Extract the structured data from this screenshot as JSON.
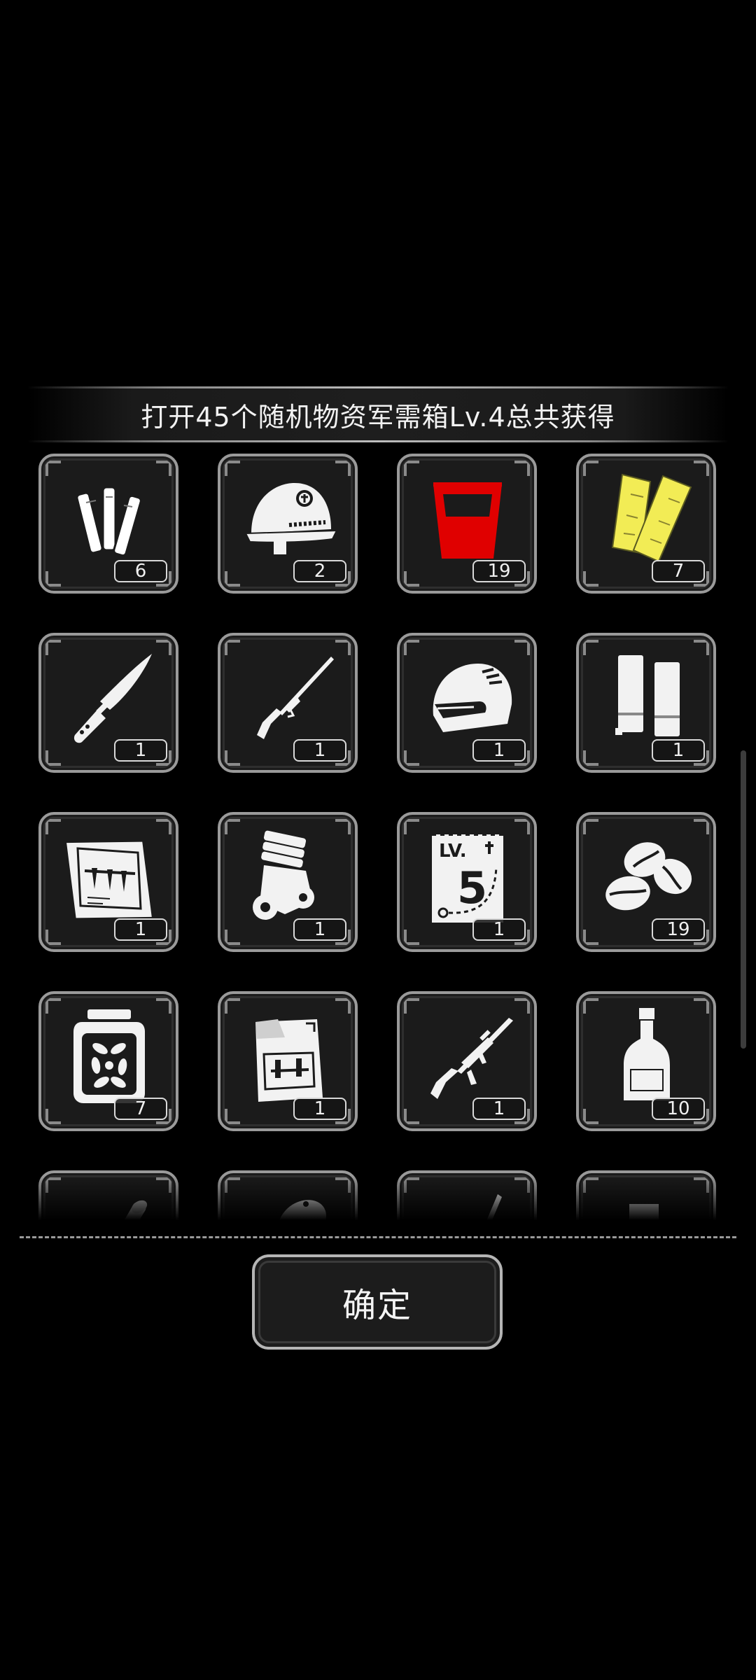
{
  "title": "打开45个随机物资军需箱Lv.4总共获得",
  "confirm_label": "确定",
  "items": [
    {
      "icon": "batteries-icon",
      "count": "6"
    },
    {
      "icon": "helmet-icon",
      "count": "2"
    },
    {
      "icon": "red-cup-icon",
      "count": "19"
    },
    {
      "icon": "wood-planks-icon",
      "count": "7"
    },
    {
      "icon": "knife-icon",
      "count": "1"
    },
    {
      "icon": "rifle-icon",
      "count": "1"
    },
    {
      "icon": "motorcycle-helmet-icon",
      "count": "1"
    },
    {
      "icon": "cylinders-icon",
      "count": "1"
    },
    {
      "icon": "blueprint-icon",
      "count": "1"
    },
    {
      "icon": "engine-icon",
      "count": "1"
    },
    {
      "icon": "level-5-card-icon",
      "count": "1"
    },
    {
      "icon": "coffee-beans-icon",
      "count": "19"
    },
    {
      "icon": "pickle-jar-icon",
      "count": "7"
    },
    {
      "icon": "blueprint-folder-icon",
      "count": "1"
    },
    {
      "icon": "assault-rifle-icon",
      "count": "1"
    },
    {
      "icon": "bottle-icon",
      "count": "10"
    },
    {
      "icon": "scroll-icon",
      "count": ""
    },
    {
      "icon": "meat-icon",
      "count": ""
    },
    {
      "icon": "sniper-rifle-icon",
      "count": ""
    },
    {
      "icon": "block-icon",
      "count": ""
    }
  ],
  "colors": {
    "accent_red": "#e00000",
    "accent_yellow": "#f2ec55",
    "frame": "#9a9a9a"
  }
}
